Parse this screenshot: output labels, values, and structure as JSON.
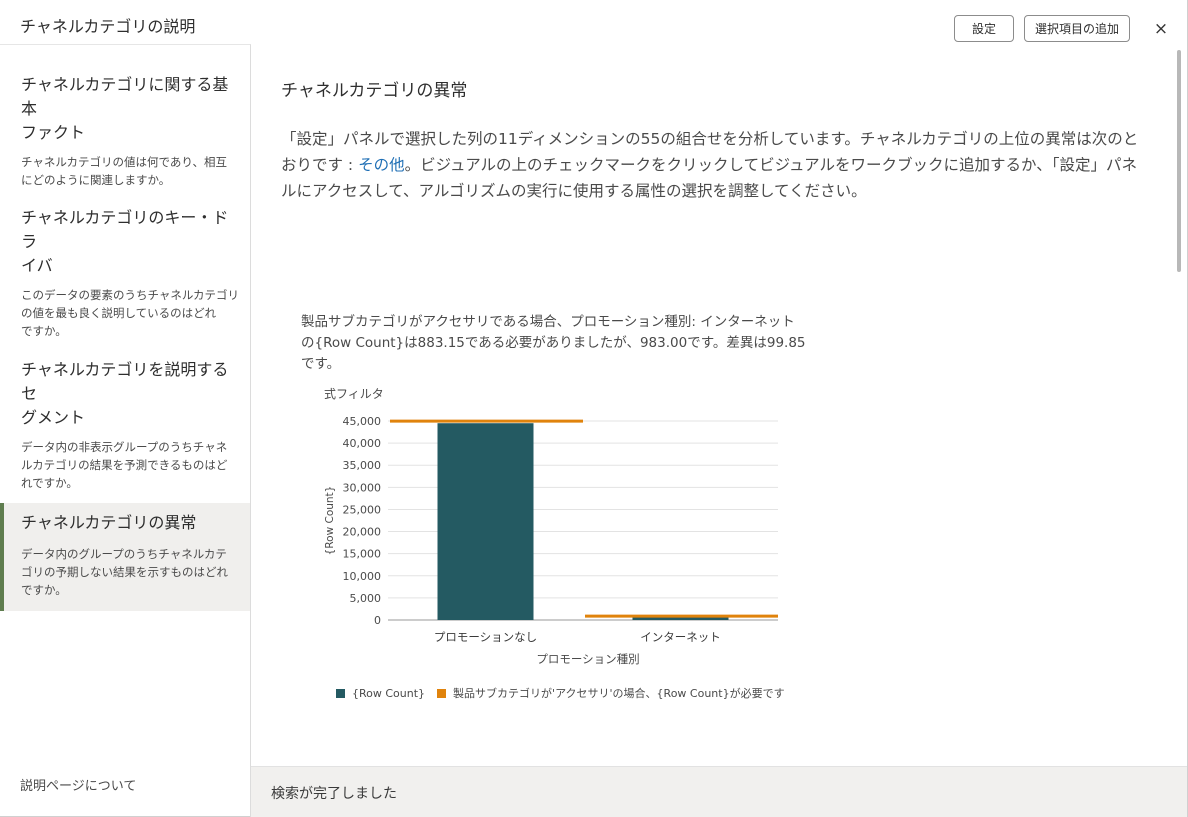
{
  "dialog": {
    "title": "チャネルカテゴリの説明",
    "settings_label": "設定",
    "add_selected_label": "選択項目の追加",
    "close_glyph": "×"
  },
  "sidebar": {
    "items": [
      {
        "title_line1": "チャネルカテゴリに関する基本",
        "title_line2": "ファクト",
        "desc_line1": "チャネルカテゴリの値は何であり、相互",
        "desc_line2": "にどのように関連しますか。",
        "desc_line3": ""
      },
      {
        "title_line1": "チャネルカテゴリのキー・ドラ",
        "title_line2": "イバ",
        "desc_line1": "このデータの要素のうちチャネルカテゴリ",
        "desc_line2": "の値を最も良く説明しているのはどれ",
        "desc_line3": "ですか。"
      },
      {
        "title_line1": "チャネルカテゴリを説明するセ",
        "title_line2": "グメント",
        "desc_line1": "データ内の非表示グループのうちチャネ",
        "desc_line2": "ルカテゴリの結果を予測できるものはど",
        "desc_line3": "れですか。"
      },
      {
        "title_line1": "チャネルカテゴリの異常",
        "title_line2": "",
        "desc_line1": "データ内のグループのうちチャネルカテ",
        "desc_line2": "ゴリの予期しない結果を示すものはどれ",
        "desc_line3": "ですか。",
        "active": true
      }
    ],
    "about_label": "説明ページについて"
  },
  "main": {
    "title": "チャネルカテゴリの異常",
    "desc_part1": "「設定」パネルで選択した列の11ディメンションの55の組合せを分析しています。チャネルカテゴリの上位の異常は次のとおりです : ",
    "desc_link": "その他",
    "desc_part2": "。ビジュアルの上のチェックマークをクリックしてビジュアルをワークブックに追加するか、「設定」パネルにアクセスして、アルゴリズムの実行に使用する属性の選択を調整してください。",
    "chart_caption": "製品サブカテゴリがアクセサリである場合、プロモーション種別: インターネットの{Row Count}は883.15である必要がありましたが、983.00です。差異は99.85です。",
    "chart_filter_label": "式フィルタ"
  },
  "status": {
    "text": "検索が完了しました"
  },
  "colors": {
    "bar": "#245a62",
    "expected": "#e0830c",
    "grid": "#e3e3e3",
    "axis": "#9a9a9a"
  },
  "chart_data": {
    "type": "bar",
    "categories": [
      "プロモーションなし",
      "インターネット"
    ],
    "series": [
      {
        "name": "{Row Count}",
        "values": [
          44500,
          983
        ]
      },
      {
        "name": "製品サブカテゴリが'アクセサリ'の場合、{Row Count}が必要です",
        "values": [
          44980,
          883.15
        ]
      }
    ],
    "xlabel": "プロモーション種別",
    "ylabel": "{Row Count}",
    "ylim": [
      0,
      45000
    ],
    "yticks": [
      0,
      5000,
      10000,
      15000,
      20000,
      25000,
      30000,
      35000,
      40000,
      45000
    ],
    "ytick_labels": [
      "0",
      "5,000",
      "10,000",
      "15,000",
      "20,000",
      "25,000",
      "30,000",
      "35,000",
      "40,000",
      "45,000"
    ],
    "grid": true,
    "legend_position": "bottom-left"
  }
}
